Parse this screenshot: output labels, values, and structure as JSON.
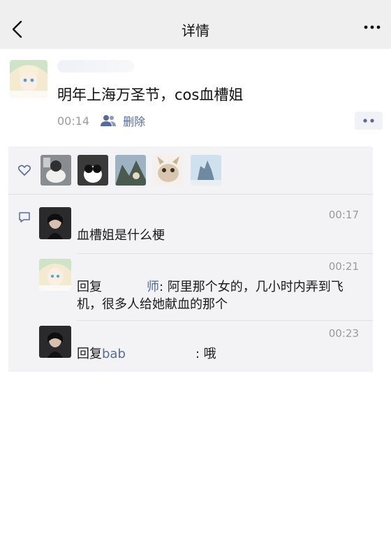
{
  "nav": {
    "title": "详情",
    "back_icon": "chevron-left-icon",
    "more_icon": "more-dots-icon"
  },
  "post": {
    "text": "明年上海万圣节，cos血槽姐",
    "time": "00:14",
    "delete_label": "删除",
    "visibility_icon": "people-icon",
    "comment_button_icon": "comment-dots-icon"
  },
  "likes": {
    "icon": "heart-icon",
    "avatars": [
      "avatar-1",
      "avatar-2",
      "avatar-3",
      "avatar-4",
      "avatar-5"
    ]
  },
  "comments": {
    "icon": "comment-bubble-icon",
    "items": [
      {
        "name": "",
        "time": "00:17",
        "reply_prefix": "",
        "reply_to": "",
        "text": "血槽姐是什么梗"
      },
      {
        "name": "",
        "time": "00:21",
        "reply_prefix": "回复",
        "reply_to": "师",
        "text": ": 阿里那个女的，几小时内弄到飞机，很多人给她献血的那个"
      },
      {
        "name": "",
        "time": "00:23",
        "reply_prefix": "回复",
        "reply_to": "bab",
        "text": ": 哦"
      }
    ]
  },
  "colors": {
    "navbar_bg": "#efefef",
    "panel_bg": "#f3f3f5",
    "link": "#576b95",
    "meta": "#9a9a9a"
  }
}
